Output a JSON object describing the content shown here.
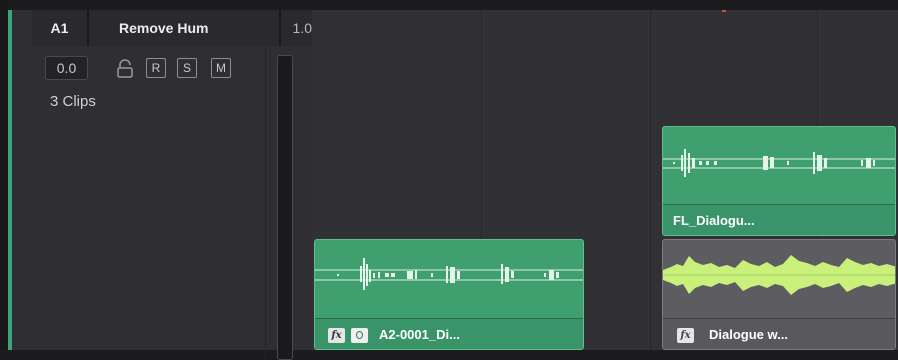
{
  "colors": {
    "track_strip": "#3aa876",
    "clip_green": "#3f9f6e",
    "clip_grey": "#5c5c61",
    "waveform_light": "#c8f07a",
    "playhead": "#d84a3a"
  },
  "track": {
    "id": "A1",
    "name": "Remove Hum",
    "level": "1.0",
    "volume": "0.0",
    "record_label": "R",
    "solo_label": "S",
    "mute_label": "M",
    "clip_count": "3 Clips"
  },
  "clips": [
    {
      "name": "A2-0001_Di...",
      "has_fx": true,
      "has_preset": true,
      "fx_label": "fx"
    },
    {
      "name": "FL_Dialogu...",
      "has_fx": false,
      "has_preset": false
    },
    {
      "name": "Dialogue w...",
      "has_fx": true,
      "has_preset": false,
      "fx_label": "fx"
    }
  ]
}
